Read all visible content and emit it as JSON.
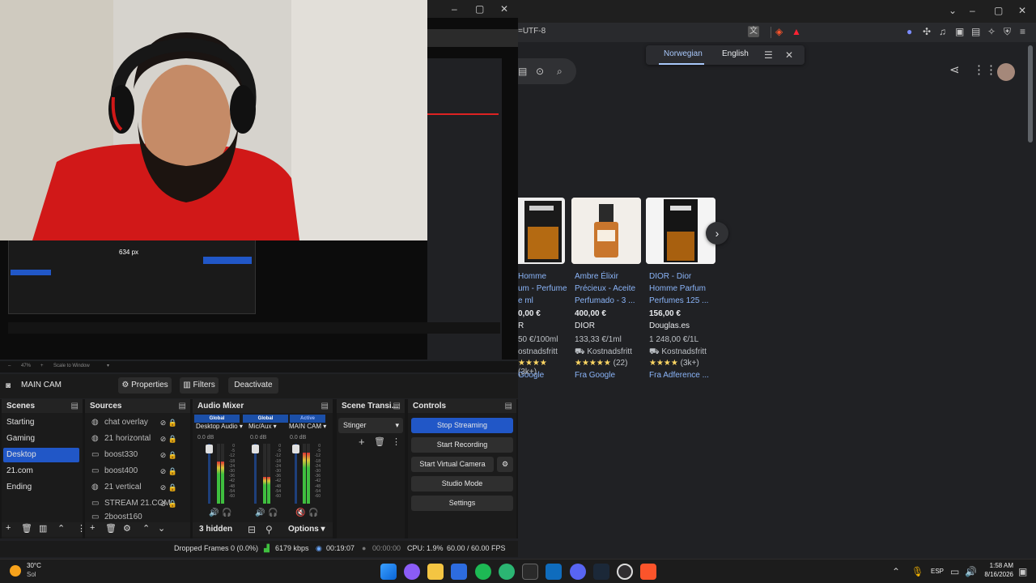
{
  "browser": {
    "url_fragment": "=UTF-8",
    "translate": {
      "languages": [
        "Norwegian",
        "English"
      ],
      "active": "Norwegian"
    },
    "products": [
      {
        "title_lines": [
          "Homme",
          "um - Perfume",
          "e ml"
        ],
        "price": "0,00 €",
        "seller": "R",
        "unit": "50 €/100ml",
        "shipping": "ostnadsfritt",
        "stars": "★★★★",
        "reviews": "(3k+)",
        "from": "Google"
      },
      {
        "title_lines": [
          "Ambre Élixir",
          "Précieux - Aceite",
          "Perfumado - 3 ..."
        ],
        "price": "400,00 €",
        "seller": "DIOR",
        "unit": "133,33 €/1ml",
        "shipping": "Kostnadsfritt",
        "stars": "★★★★★",
        "reviews": "(22)",
        "from": "Fra Google"
      },
      {
        "title_lines": [
          "DIOR - Dior",
          "Homme Parfum",
          "Perfumes 125 ..."
        ],
        "price": "156,00 €",
        "seller": "Douglas.es",
        "unit": "1 248,00 €/1L",
        "shipping": "Kostnadsfritt",
        "stars": "★★★★",
        "reviews": "(3k+)",
        "from": "Fra Adference ..."
      }
    ]
  },
  "obs": {
    "context": {
      "source": "MAIN CAM",
      "properties": "Properties",
      "filters": "Filters",
      "deactivate": "Deactivate"
    },
    "docks": {
      "scenes": "Scenes",
      "sources": "Sources",
      "mixer": "Audio Mixer",
      "transitions": "Scene Transi...",
      "controls": "Controls"
    },
    "scenes": [
      "Starting",
      "Gaming",
      "Desktop",
      "21.com",
      "Ending"
    ],
    "selected_scene": "Desktop",
    "sources": [
      "chat overlay",
      "21 horizontal",
      "boost330",
      "boost400",
      "21 vertical",
      "STREAM 21.COM",
      "2boost160"
    ],
    "mixer": {
      "tabs": [
        "Global",
        "Global",
        "Active"
      ],
      "channels": [
        {
          "name": "Desktop Audio",
          "db": "0.0 dB",
          "level": 0.7
        },
        {
          "name": "Mic/Aux",
          "db": "0.0 dB",
          "level": 0.45
        },
        {
          "name": "MAIN CAM",
          "db": "0.0 dB",
          "level": 0.85
        }
      ],
      "ticks": [
        "0",
        "-5",
        "-12",
        "-18",
        "-24",
        "-30",
        "-36",
        "-42",
        "-48",
        "-54",
        "-60"
      ],
      "hidden": "3 hidden",
      "options": "Options"
    },
    "transition": {
      "selected": "Stinger"
    },
    "controls": [
      "Stop Streaming",
      "Start Recording",
      "Start Virtual Camera",
      "Studio Mode",
      "Settings"
    ],
    "status": {
      "dropped": "Dropped Frames 0 (0.0%)",
      "bitrate": "6179 kbps",
      "stream_time": "00:19:07",
      "rec_time": "00:00:00",
      "cpu": "CPU: 1.9%",
      "fps": "60.00 / 60.00 FPS"
    },
    "preview": {
      "scale": "Scale to Window",
      "zoom": "47%",
      "overlay_text": "634 px"
    }
  },
  "taskbar": {
    "weather_temp": "30°C",
    "weather_label": "Sol",
    "lang": "ESP",
    "time": "1:58 AM",
    "date": "8/16/2026"
  },
  "colors": {
    "accent": "#2157c7",
    "link": "#8ab4f8",
    "star": "#fdd663"
  }
}
